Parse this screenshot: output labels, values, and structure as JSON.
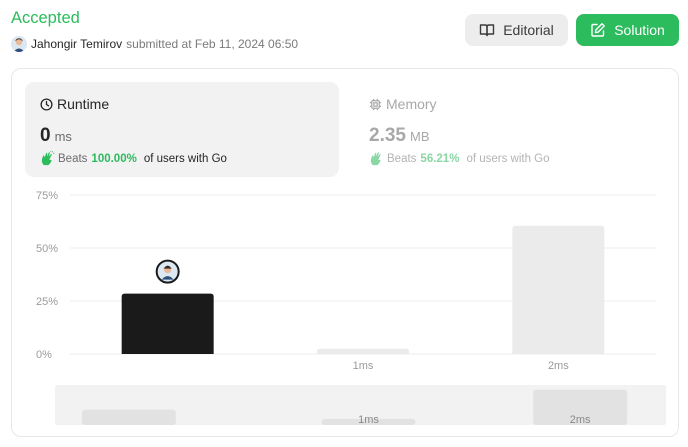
{
  "status": {
    "text": "Accepted",
    "color": "#2cbb5d"
  },
  "submission": {
    "author": "Jahongir Temirov",
    "submitted_text": "submitted at Feb 11, 2024 06:50"
  },
  "buttons": {
    "editorial": {
      "label": "Editorial",
      "icon": "book-icon"
    },
    "solution": {
      "label": "Solution",
      "icon": "edit-icon"
    }
  },
  "stats": {
    "runtime": {
      "title": "Runtime",
      "icon": "clock-icon",
      "value": "0",
      "unit": "ms",
      "beats_label": "Beats",
      "beats_pct": "100.00%",
      "beats_suffix": "of users with Go"
    },
    "memory": {
      "title": "Memory",
      "icon": "chip-icon",
      "value": "2.35",
      "unit": "MB",
      "beats_label": "Beats",
      "beats_pct": "56.21%",
      "beats_suffix": "of users with Go"
    }
  },
  "chart_data": {
    "type": "bar",
    "title": "",
    "xlabel": "",
    "ylabel": "",
    "y_ticks": [
      "75%",
      "50%",
      "25%",
      "0%"
    ],
    "ylim": [
      0,
      75
    ],
    "categories": [
      "",
      "1ms",
      "2ms"
    ],
    "values": [
      28.5,
      2.5,
      60.5
    ],
    "highlight_index": 0,
    "colors": {
      "highlight": "#1a1a1a",
      "default": "#ebebeb",
      "grid": "#ededed",
      "tick_label": "#9b9b9b"
    },
    "grid": true,
    "minimap": {
      "labels": [
        "",
        "1ms",
        "2ms"
      ],
      "values": [
        20,
        8,
        46
      ]
    }
  }
}
